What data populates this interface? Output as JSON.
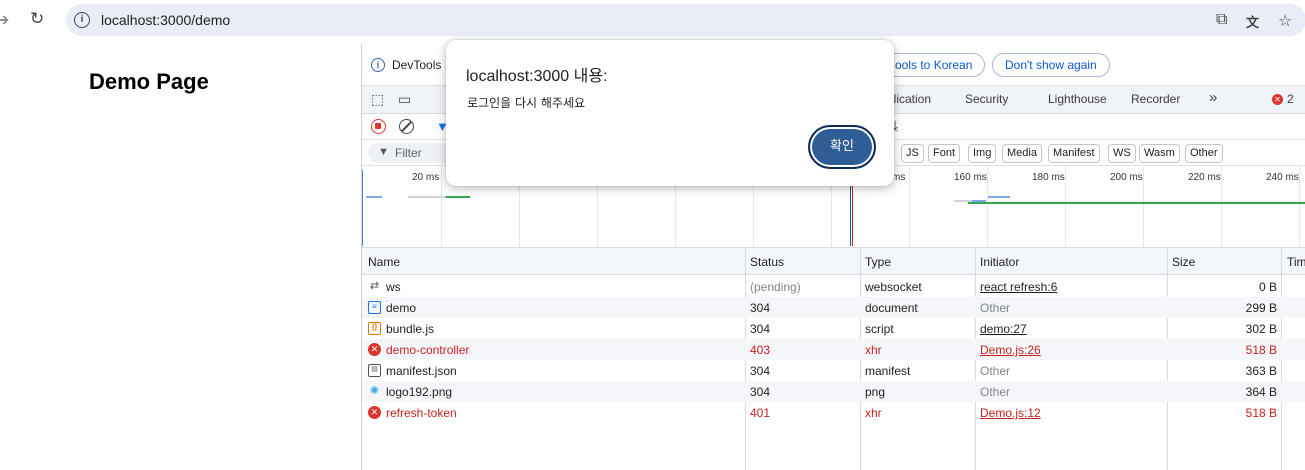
{
  "browser": {
    "url": "localhost:3000/demo",
    "forward_icon": "arrow-right-icon",
    "reload_icon": "reload-icon",
    "site_info_icon": "info-icon"
  },
  "page": {
    "title": "Demo Page"
  },
  "devtools": {
    "info_bar": {
      "text": "DevTools",
      "switch_button": "ools to Korean",
      "dont_show_button": "Don't show again"
    },
    "tabs": {
      "application": "plication",
      "security": "Security",
      "lighthouse": "Lighthouse",
      "recorder": "Recorder",
      "more": "»",
      "error_count": "2"
    },
    "filter": {
      "placeholder": "Filter",
      "chips": [
        "JS",
        "Font",
        "Img",
        "Media",
        "Manifest",
        "WS",
        "Wasm",
        "Other"
      ]
    },
    "timeline": {
      "ticks": [
        "20 ms",
        "ms",
        "160 ms",
        "180 ms",
        "200 ms",
        "220 ms",
        "240 ms"
      ]
    },
    "columns": {
      "name": "Name",
      "status": "Status",
      "type": "Type",
      "initiator": "Initiator",
      "size": "Size",
      "time": "Tim"
    },
    "requests": [
      {
        "name": "ws",
        "status": "(pending)",
        "type": "websocket",
        "initiator": "react refresh:6",
        "size": "0 B",
        "icon": "websocket-icon",
        "error": false
      },
      {
        "name": "demo",
        "status": "304",
        "type": "document",
        "initiator": "Other",
        "size": "299 B",
        "icon": "document-icon",
        "error": false
      },
      {
        "name": "bundle.js",
        "status": "304",
        "type": "script",
        "initiator": "demo:27",
        "size": "302 B",
        "icon": "script-icon",
        "error": false
      },
      {
        "name": "demo-controller",
        "status": "403",
        "type": "xhr",
        "initiator": "Demo.js:26",
        "size": "518 B",
        "icon": "error-icon",
        "error": true
      },
      {
        "name": "manifest.json",
        "status": "304",
        "type": "manifest",
        "initiator": "Other",
        "size": "363 B",
        "icon": "file-icon",
        "error": false
      },
      {
        "name": "logo192.png",
        "status": "304",
        "type": "png",
        "initiator": "Other",
        "size": "364 B",
        "icon": "image-icon",
        "error": false
      },
      {
        "name": "refresh-token",
        "status": "401",
        "type": "xhr",
        "initiator": "Demo.js:12",
        "size": "518 B",
        "icon": "error-icon",
        "error": true
      }
    ]
  },
  "dialog": {
    "title": "localhost:3000 내용:",
    "message": "로그인을 다시 해주세요",
    "ok_label": "확인"
  },
  "colors": {
    "accent": "#1a73e8",
    "error": "#c5221f",
    "dialog_button": "#2f5d96"
  }
}
